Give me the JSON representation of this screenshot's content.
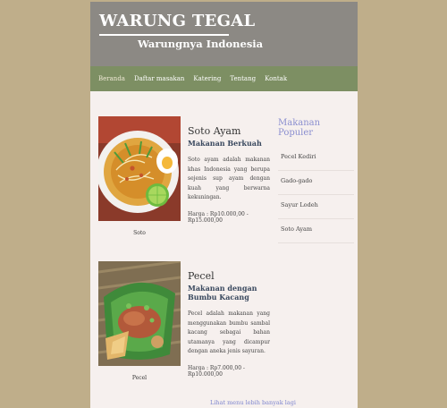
{
  "header": {
    "title": "WARUNG TEGAL",
    "tagline": "Warungnya Indonesia"
  },
  "nav": {
    "items": [
      "Beranda",
      "Daftar masakan",
      "Katering",
      "Tentang",
      "Kontak"
    ],
    "active": "Beranda"
  },
  "articles": [
    {
      "caption": "Soto",
      "title": "Soto Ayam",
      "subtitle": "Makanan Berkuah",
      "description": "Soto ayam adalah makanan khas Indonesia yang berupa sejenis sup ayam dengan kuah yang berwarna kekuningan.",
      "price": "Harga : Rp10.000,00 - Rp15.000,00"
    },
    {
      "caption": "Pecel",
      "title": "Pecel",
      "subtitle": "Makanan dengan Bumbu Kacang",
      "description": "Pecel adalah makanan yang menggunakan bumbu sambal kacang sebagai bahan utamanya yang dicampur dengan aneka jenis sayuran.",
      "price": "Harga : Rp7.000,00 - Rp10.000,00"
    }
  ],
  "sidebar": {
    "title": "Makanan Populer",
    "items": [
      "Pecel Kediri",
      "Gado-gado",
      "Sayur Lodeh",
      "Soto Ayam"
    ]
  },
  "more_link": "Lihat menu lebih banyak lagi"
}
